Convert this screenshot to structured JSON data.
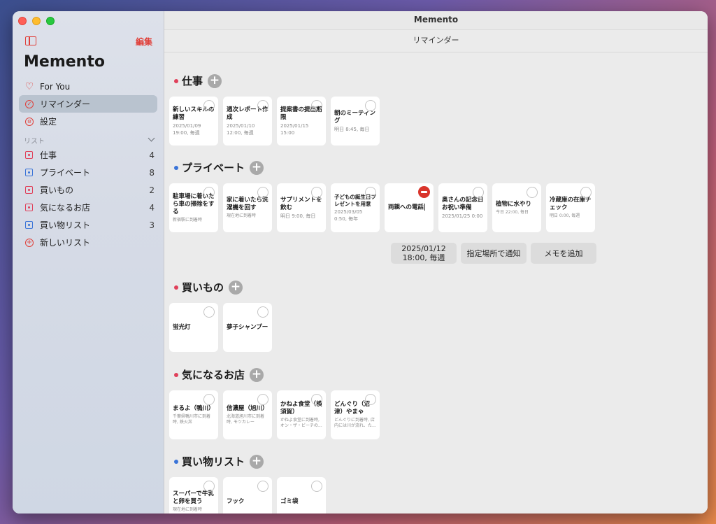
{
  "app": {
    "title": "Memento",
    "window_title": "Memento",
    "edit_label": "編集"
  },
  "main": {
    "subtitle": "リマインダー"
  },
  "nav": [
    {
      "label": "For You",
      "icon": "heart-icon"
    },
    {
      "label": "リマインダー",
      "icon": "checkmark-circle-icon",
      "selected": true
    },
    {
      "label": "設定",
      "icon": "gear-icon"
    }
  ],
  "lists_header": "リスト",
  "lists": [
    {
      "label": "仕事",
      "count": "4",
      "color": "#e0405a"
    },
    {
      "label": "プライベート",
      "count": "8",
      "color": "#3a74d8"
    },
    {
      "label": "買いもの",
      "count": "2",
      "color": "#e0405a"
    },
    {
      "label": "気になるお店",
      "count": "4",
      "color": "#e0405a"
    },
    {
      "label": "買い物リスト",
      "count": "3",
      "color": "#3a74d8"
    }
  ],
  "new_list_label": "新しいリスト",
  "sections": [
    {
      "title": "仕事",
      "color": "#e0405a",
      "cards": [
        {
          "title": "新しいスキルの練習",
          "sub": "2025/01/09 19:00, 毎週"
        },
        {
          "title": "週次レポート作成",
          "sub": "2025/01/10 12:00, 毎週"
        },
        {
          "title": "提案書の提出期限",
          "sub": "2025/01/15 15:00"
        },
        {
          "title": "朝のミーティング",
          "sub": "明日 8:45, 毎日"
        }
      ]
    },
    {
      "title": "プライベート",
      "color": "#3a74d8",
      "cards": [
        {
          "title": "駐車場に着いたら車の掃除をする",
          "sub": "新宿駅に到着時"
        },
        {
          "title": "家に着いたら洗濯機を回す",
          "sub": "現在地に到着時"
        },
        {
          "title": "サプリメントを飲む",
          "sub": "明日 9:00, 毎日"
        },
        {
          "title": "子どもの誕生日プレゼントを用意",
          "sub": "2025/03/05 0:50, 毎年"
        },
        {
          "title": "両親への電話",
          "sub": ""
        },
        {
          "title": "奥さんの記念日お祝い準備",
          "sub": "2025/01/25 0:00"
        },
        {
          "title": "植物に水やり",
          "sub": "今日 22:00, 毎日"
        },
        {
          "title": "冷蔵庫の在庫チェック",
          "sub": "明日 0:00, 毎週"
        }
      ]
    },
    {
      "title": "買いもの",
      "color": "#e0405a",
      "cards": [
        {
          "title": "蛍光灯",
          "sub": ""
        },
        {
          "title": "夢子シャンプー",
          "sub": ""
        }
      ]
    },
    {
      "title": "気になるお店",
      "color": "#e0405a",
      "cards": [
        {
          "title": "まるよ（鴨川）",
          "sub": "千葉県鴨川市に到着時, 鉄火丼"
        },
        {
          "title": "信濃屋（旭川）",
          "sub": "北海道旭川市に到着時, モツカレー"
        },
        {
          "title": "かねよ食堂（横須賀）",
          "sub": "かねよ食堂に到着時, オン・ザ・ビーチの..."
        },
        {
          "title": "どんぐり（沼津）やまゃ",
          "sub": "どんぐりに到着時, 店内には川が流れ、た..."
        }
      ]
    },
    {
      "title": "買い物リスト",
      "color": "#3a74d8",
      "cards": [
        {
          "title": "スーパーで牛乳と卵を買う",
          "sub": "現在地に到着時"
        },
        {
          "title": "フック",
          "sub": ""
        },
        {
          "title": "ゴミ袋",
          "sub": ""
        }
      ]
    }
  ],
  "popover": {
    "date_label": "2025/01/12\n18:00, 毎週",
    "date_line1": "2025/01/12",
    "date_line2": "18:00, 毎週",
    "location_label": "指定場所で通知",
    "memo_label": "メモを追加"
  }
}
